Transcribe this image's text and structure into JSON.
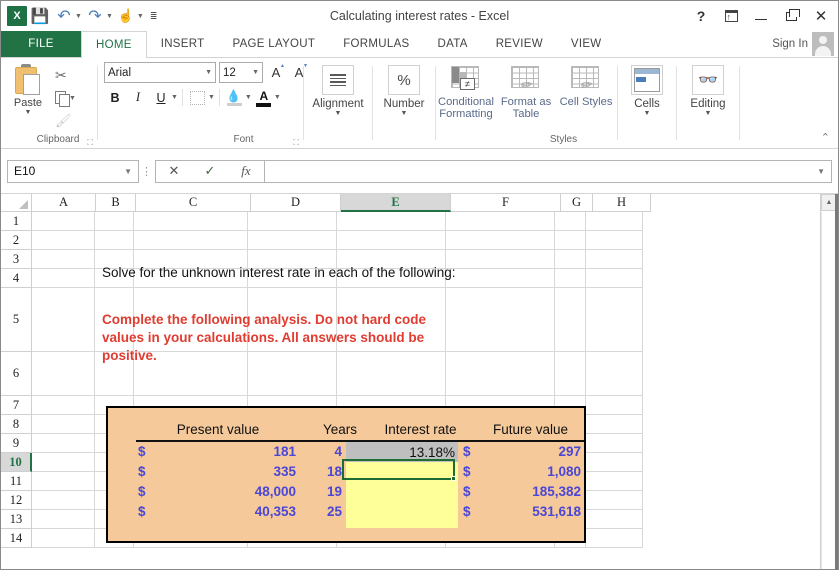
{
  "window": {
    "title": "Calculating interest rates - Excel",
    "app_logo": "excel-logo",
    "quick_access": [
      {
        "name": "save-icon",
        "glyph": "▤"
      },
      {
        "name": "undo-icon",
        "glyph": "↶"
      },
      {
        "name": "redo-icon",
        "glyph": "↷"
      },
      {
        "name": "touch-mode-icon",
        "glyph": "☝"
      },
      {
        "name": "customize-qat-icon",
        "glyph": "≡"
      }
    ],
    "controls": {
      "help": "?",
      "ribbon_display_options": "ribbon-options-icon",
      "minimize": "–",
      "restore": "restore-icon",
      "close": "✕"
    }
  },
  "ribbon": {
    "tabs": [
      {
        "label": "FILE",
        "active": false,
        "is_file": true
      },
      {
        "label": "HOME",
        "active": true
      },
      {
        "label": "INSERT",
        "active": false
      },
      {
        "label": "PAGE LAYOUT",
        "active": false
      },
      {
        "label": "FORMULAS",
        "active": false
      },
      {
        "label": "DATA",
        "active": false
      },
      {
        "label": "REVIEW",
        "active": false
      },
      {
        "label": "VIEW",
        "active": false
      }
    ],
    "sign_in": "Sign In",
    "groups": {
      "clipboard": {
        "label": "Clipboard",
        "paste": "Paste",
        "cut": "cut-icon",
        "copy": "copy-icon",
        "format_painter": "format-painter-icon"
      },
      "font": {
        "label": "Font",
        "font_name": "Arial",
        "font_size": "12",
        "grow_font": "A",
        "shrink_font": "A",
        "bold": "B",
        "italic": "I",
        "underline": "U",
        "borders": "borders-icon",
        "fill_color": "fill-color-icon",
        "font_color": "A"
      },
      "alignment": {
        "label": "Alignment"
      },
      "number": {
        "label": "Number",
        "icon": "%"
      },
      "styles": {
        "label": "Styles",
        "conditional_formatting": "Conditional Formatting",
        "format_as_table": "Format as Table",
        "cell_styles": "Cell Styles",
        "cf_symbol": "≠"
      },
      "cells": {
        "label": "Cells"
      },
      "editing": {
        "label": "Editing"
      }
    },
    "collapse": "⌃"
  },
  "formula_bar": {
    "name_box": "E10",
    "cancel": "✕",
    "enter": "✓",
    "insert_function": "fx",
    "formula_value": "",
    "expand": "⌄"
  },
  "grid": {
    "columns": [
      "A",
      "B",
      "C",
      "D",
      "E",
      "F",
      "G",
      "H"
    ],
    "selected_column": "E",
    "rows": [
      "1",
      "2",
      "3",
      "4",
      "5",
      "6",
      "7",
      "8",
      "9",
      "10",
      "11",
      "12",
      "13",
      "14"
    ],
    "selected_row": "10",
    "selected_cell": "E10"
  },
  "sheet_content": {
    "instruction": "Solve for the unknown interest rate in each of the following:",
    "warning_lines": [
      "Complete the following analysis. Do not hard code",
      "values in your calculations. All answers should be",
      "positive."
    ],
    "table": {
      "headers": [
        "Present value",
        "Years",
        "Interest rate",
        "Future value"
      ],
      "rows": [
        {
          "pv_sym": "$",
          "pv": "181",
          "years": "4",
          "rate": "13.18%",
          "fv_sym": "$",
          "fv": "297"
        },
        {
          "pv_sym": "$",
          "pv": "335",
          "years": "18",
          "rate": "",
          "fv_sym": "$",
          "fv": "1,080"
        },
        {
          "pv_sym": "$",
          "pv": "48,000",
          "years": "19",
          "rate": "",
          "fv_sym": "$",
          "fv": "185,382"
        },
        {
          "pv_sym": "$",
          "pv": "40,353",
          "years": "25",
          "rate": "",
          "fv_sym": "$",
          "fv": "531,618"
        }
      ]
    }
  },
  "colors": {
    "excel_green": "#217346",
    "table_fill": "#f5c99a",
    "input_yellow": "#ffff99",
    "grey_cell": "#bfbfbf",
    "number_blue": "#4a46d6",
    "warning_red": "#e03c31",
    "selection_green": "#1f6b35"
  },
  "scrollbar": {
    "up_arrow": "▲"
  }
}
